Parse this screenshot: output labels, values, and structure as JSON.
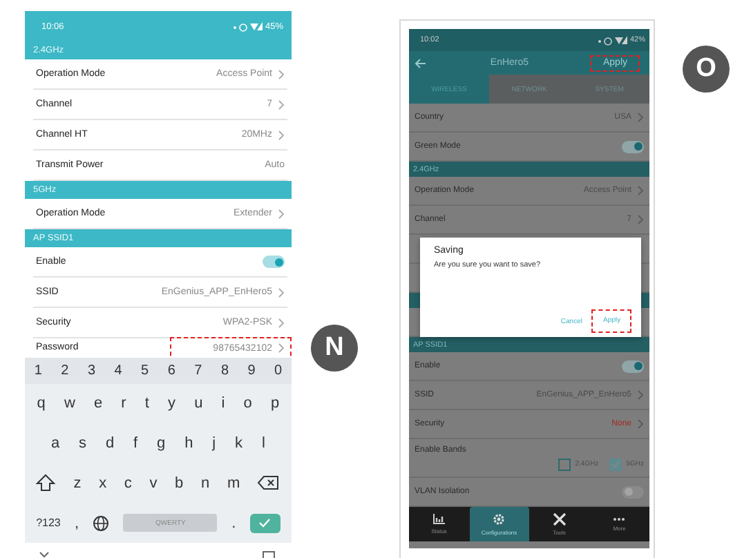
{
  "left_phone": {
    "status_bar": {
      "time": "10:06",
      "battery": "45%"
    },
    "rows": [
      {
        "kind": "header",
        "label": "2.4GHz"
      },
      {
        "kind": "link",
        "label": "Operation Mode",
        "value": "Access Point",
        "highlighted": false
      },
      {
        "kind": "link",
        "label": "Channel",
        "value": "7",
        "highlighted": false
      },
      {
        "kind": "link",
        "label": "Channel HT",
        "value": "20MHz",
        "highlighted": false
      },
      {
        "kind": "plain",
        "label": "Transmit Power",
        "value": "Auto"
      },
      {
        "kind": "header",
        "label": "5GHz"
      },
      {
        "kind": "link",
        "label": "Operation Mode",
        "value": "Extender",
        "highlighted": false
      },
      {
        "kind": "header",
        "label": "AP SSID1"
      },
      {
        "kind": "toggle",
        "label": "Enable",
        "on": true
      },
      {
        "kind": "link",
        "label": "SSID",
        "value": "EnGenius_APP_EnHero5",
        "highlighted": false
      },
      {
        "kind": "link",
        "label": "Security",
        "value": "WPA2-PSK",
        "highlighted": false
      },
      {
        "kind": "link",
        "label": "Password",
        "value": "98765432102",
        "highlighted": true
      }
    ],
    "keyboard": {
      "number_row": [
        "1",
        "2",
        "3",
        "4",
        "5",
        "6",
        "7",
        "8",
        "9",
        "0"
      ],
      "letter_rows": [
        [
          "q",
          "w",
          "e",
          "r",
          "t",
          "y",
          "u",
          "i",
          "o",
          "p"
        ],
        [
          "a",
          "s",
          "d",
          "f",
          "g",
          "h",
          "j",
          "k",
          "l"
        ],
        [
          "z",
          "x",
          "c",
          "v",
          "b",
          "n",
          "m"
        ]
      ],
      "symbols_key": "?123",
      "comma_key": ",",
      "space_key": "QWERTY",
      "period_key": "."
    }
  },
  "right_phone": {
    "status_bar": {
      "time": "10:02",
      "battery": "42%"
    },
    "app_bar": {
      "title": "EnHero5",
      "action": "Apply",
      "action_highlighted": true
    },
    "tabs": [
      {
        "label": "WIRELESS",
        "selected": true
      },
      {
        "label": "NETWORK",
        "selected": false
      },
      {
        "label": "SYSTEM",
        "selected": false
      }
    ],
    "rows": [
      {
        "kind": "link",
        "label": "Country",
        "value": "USA"
      },
      {
        "kind": "toggle",
        "label": "Green Mode",
        "on": true
      },
      {
        "kind": "header",
        "label": "2.4GHz"
      },
      {
        "kind": "link",
        "label": "Operation Mode",
        "value": "Access Point"
      },
      {
        "kind": "link",
        "label": "Channel",
        "value": "7"
      },
      {
        "kind": "covered"
      },
      {
        "kind": "covered"
      },
      {
        "kind": "covered_header"
      },
      {
        "kind": "covered"
      },
      {
        "kind": "header",
        "label": "AP SSID1"
      },
      {
        "kind": "toggle",
        "label": "Enable",
        "on": true
      },
      {
        "kind": "link",
        "label": "SSID",
        "value": "EnGenius_APP_EnHero5"
      },
      {
        "kind": "warning",
        "label": "Security",
        "value": "None"
      },
      {
        "kind": "bands",
        "label": "Enable Bands",
        "options": [
          {
            "label": "2.4GHz",
            "checked": false
          },
          {
            "label": "5GHz",
            "checked": true
          }
        ]
      },
      {
        "kind": "toggle",
        "label": "VLAN Isolation",
        "on": false
      }
    ],
    "dialog": {
      "title": "Saving",
      "message": "Are you sure you want to save?",
      "buttons": [
        {
          "label": "Cancel",
          "highlighted": false
        },
        {
          "label": "Apply",
          "highlighted": true
        }
      ]
    },
    "bottom_nav": [
      {
        "label": "Status",
        "selected": false
      },
      {
        "label": "Configurations",
        "selected": true
      },
      {
        "label": "Tools",
        "selected": false
      },
      {
        "label": "More",
        "selected": false
      }
    ]
  },
  "callouts": [
    {
      "letter": "N"
    },
    {
      "letter": "O"
    }
  ]
}
